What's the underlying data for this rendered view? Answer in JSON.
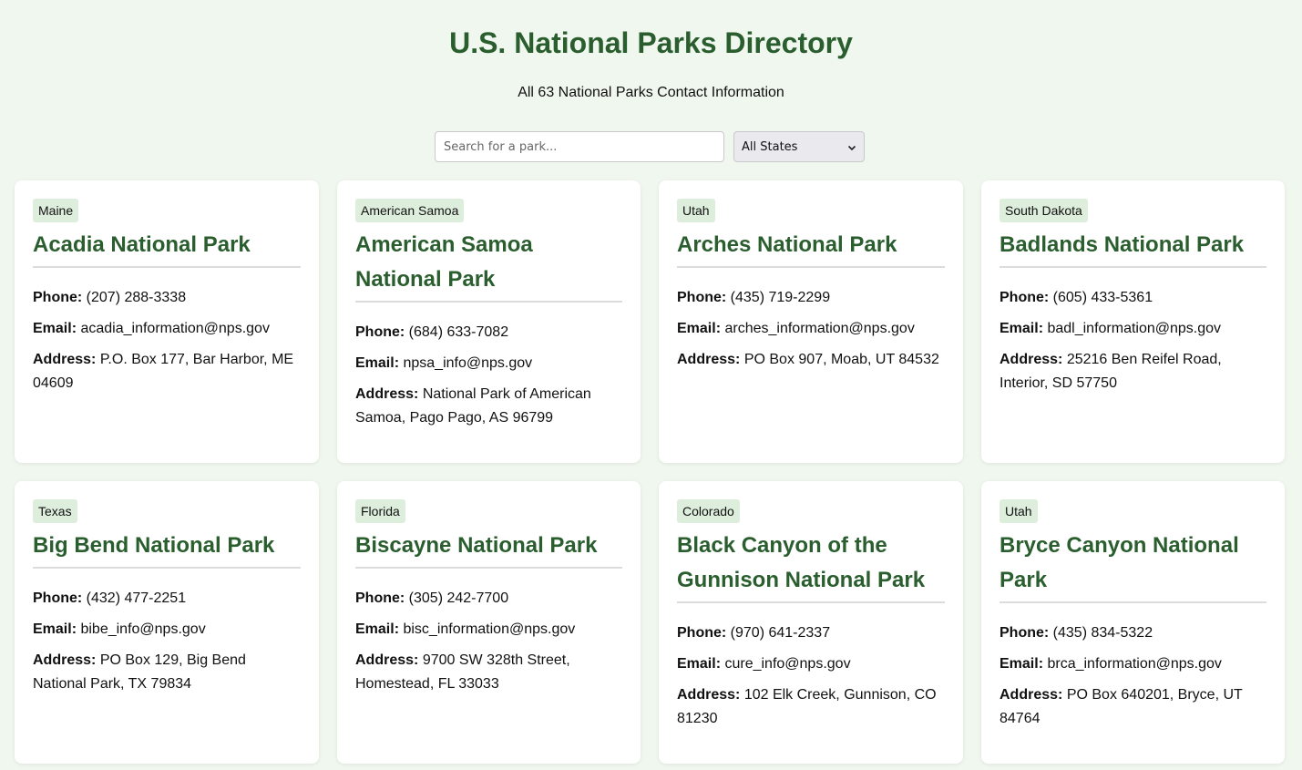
{
  "header": {
    "title": "U.S. National Parks Directory",
    "subtitle": "All 63 National Parks Contact Information"
  },
  "search": {
    "placeholder": "Search for a park..."
  },
  "state_filter": {
    "selected": "All States",
    "icon": "chevron-down-icon"
  },
  "labels": {
    "phone": "Phone:",
    "email": "Email:",
    "address": "Address:"
  },
  "parks": [
    {
      "state": "Maine",
      "name": "Acadia National Park",
      "phone": "(207) 288-3338",
      "email": "acadia_information@nps.gov",
      "address": "P.O. Box 177, Bar Harbor, ME 04609"
    },
    {
      "state": "American Samoa",
      "name": "American Samoa National Park",
      "phone": "(684) 633-7082",
      "email": "npsa_info@nps.gov",
      "address": "National Park of American Samoa, Pago Pago, AS 96799"
    },
    {
      "state": "Utah",
      "name": "Arches National Park",
      "phone": "(435) 719-2299",
      "email": "arches_information@nps.gov",
      "address": "PO Box 907, Moab, UT 84532"
    },
    {
      "state": "South Dakota",
      "name": "Badlands National Park",
      "phone": "(605) 433-5361",
      "email": "badl_information@nps.gov",
      "address": "25216 Ben Reifel Road, Interior, SD 57750"
    },
    {
      "state": "Texas",
      "name": "Big Bend National Park",
      "phone": "(432) 477-2251",
      "email": "bibe_info@nps.gov",
      "address": "PO Box 129, Big Bend National Park, TX 79834"
    },
    {
      "state": "Florida",
      "name": "Biscayne National Park",
      "phone": "(305) 242-7700",
      "email": "bisc_information@nps.gov",
      "address": "9700 SW 328th Street, Homestead, FL 33033"
    },
    {
      "state": "Colorado",
      "name": "Black Canyon of the Gunnison National Park",
      "phone": "(970) 641-2337",
      "email": "cure_info@nps.gov",
      "address": "102 Elk Creek, Gunnison, CO 81230"
    },
    {
      "state": "Utah",
      "name": "Bryce Canyon National Park",
      "phone": "(435) 834-5322",
      "email": "brca_information@nps.gov",
      "address": "PO Box 640201, Bryce, UT 84764"
    }
  ]
}
